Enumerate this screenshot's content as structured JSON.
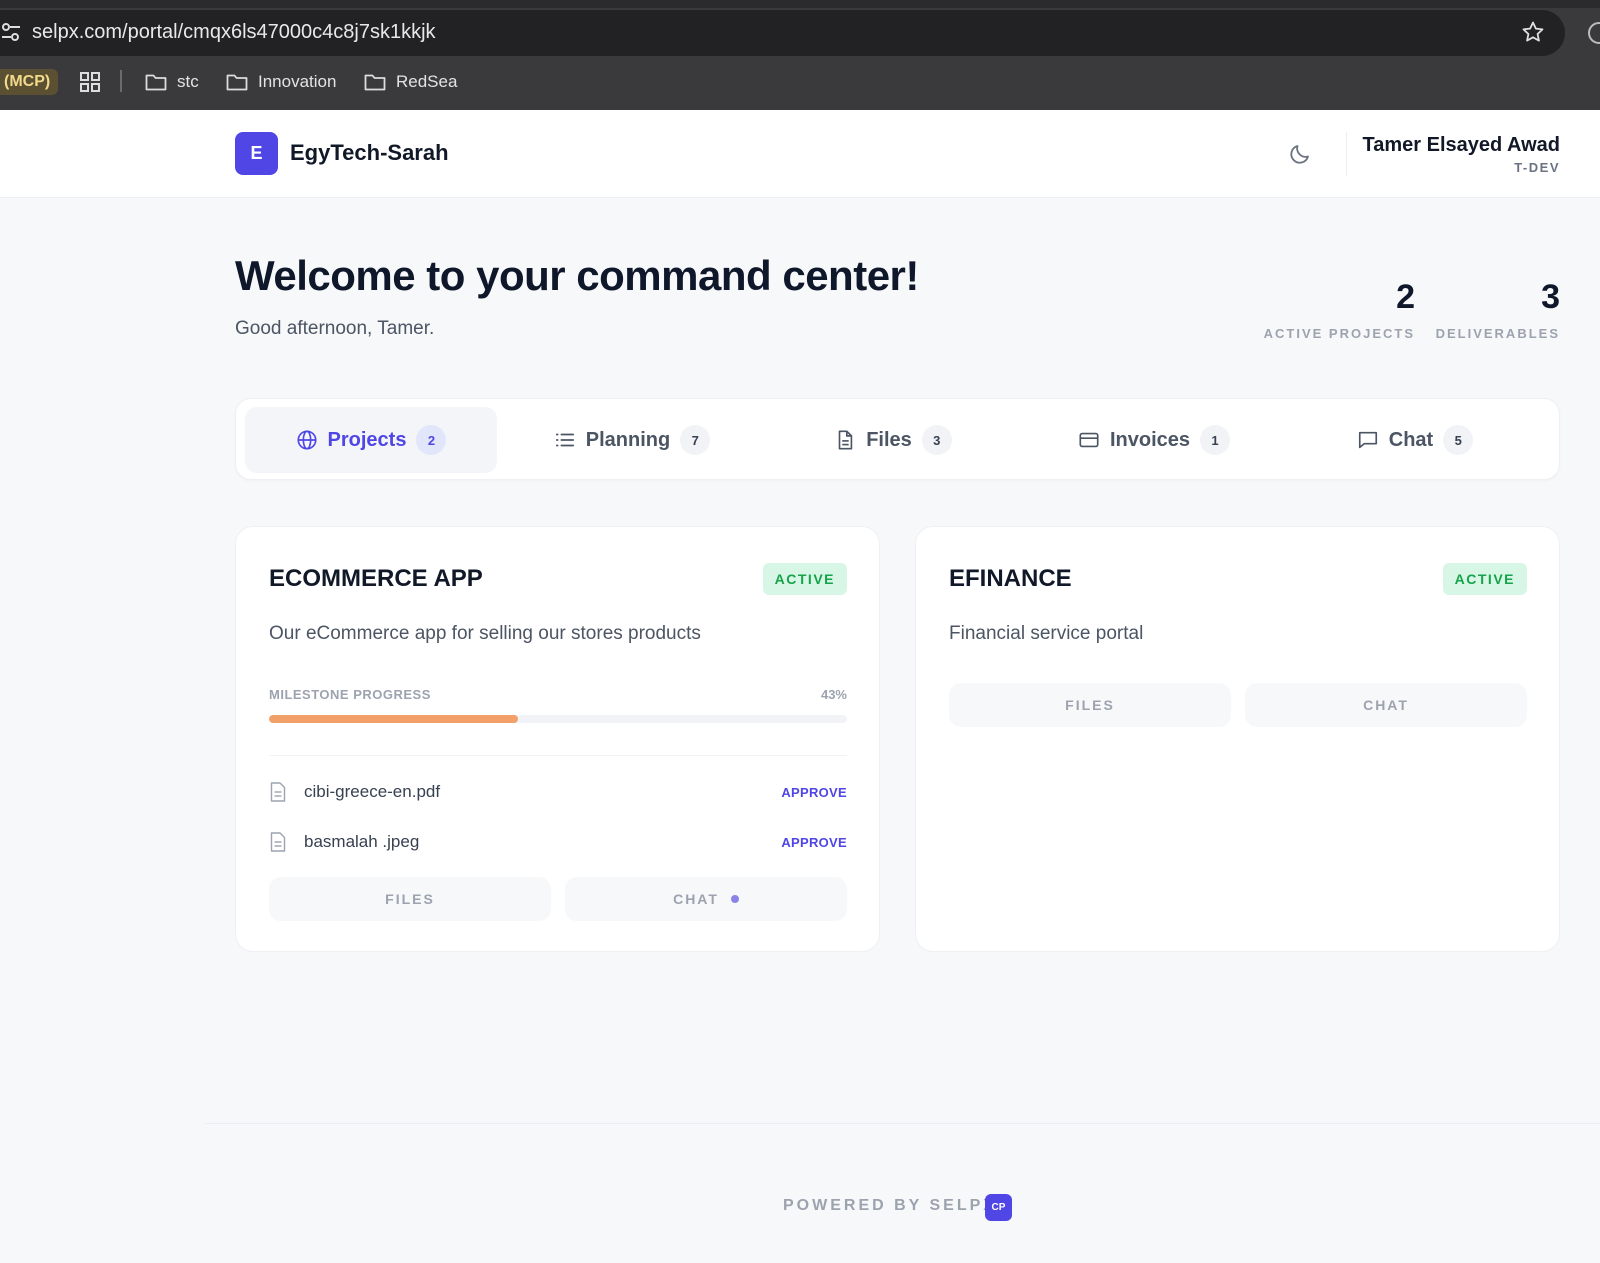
{
  "browser": {
    "url": "selpx.com/portal/cmqx6ls47000c4c8j7sk1kkjk",
    "bookmarks": {
      "mcp": "(MCP)",
      "folders": [
        "stc",
        "Innovation",
        "RedSea"
      ]
    }
  },
  "header": {
    "logo_letter": "E",
    "brand": "EgyTech-Sarah",
    "user_name": "Tamer Elsayed Awad",
    "user_role": "T-DEV"
  },
  "welcome": {
    "title": "Welcome to your command center!",
    "greeting": "Good afternoon, Tamer."
  },
  "stats": [
    {
      "value": "2",
      "label": "ACTIVE PROJECTS"
    },
    {
      "value": "3",
      "label": "DELIVERABLES"
    }
  ],
  "tabs": [
    {
      "label": "Projects",
      "count": "2",
      "icon": "globe-icon",
      "active": true
    },
    {
      "label": "Planning",
      "count": "7",
      "icon": "list-icon"
    },
    {
      "label": "Files",
      "count": "3",
      "icon": "document-icon"
    },
    {
      "label": "Invoices",
      "count": "1",
      "icon": "credit-card-icon"
    },
    {
      "label": "Chat",
      "count": "5",
      "icon": "chat-icon"
    }
  ],
  "projects": [
    {
      "title": "ECOMMERCE APP",
      "status": "ACTIVE",
      "description": "Our eCommerce app for selling our stores products",
      "progress_label": "MILESTONE PROGRESS",
      "progress_text": "43%",
      "progress": 0.43,
      "files": [
        {
          "name": "cibi-greece-en.pdf",
          "action": "APPROVE"
        },
        {
          "name": "basmalah .jpeg",
          "action": "APPROVE"
        }
      ],
      "files_button": "FILES",
      "chat_button": "CHAT"
    },
    {
      "title": "EFINANCE",
      "status": "ACTIVE",
      "description": "Financial service portal",
      "files_button": "FILES",
      "chat_button": "CHAT"
    }
  ],
  "footer": {
    "powered": "POWERED BY SELPX",
    "logo": "CP"
  },
  "colors": {
    "accent": "#4f46e5",
    "active_badge_bg": "#d7f6e6",
    "active_badge_text": "#16a34a",
    "progress": "#f2a06a"
  }
}
